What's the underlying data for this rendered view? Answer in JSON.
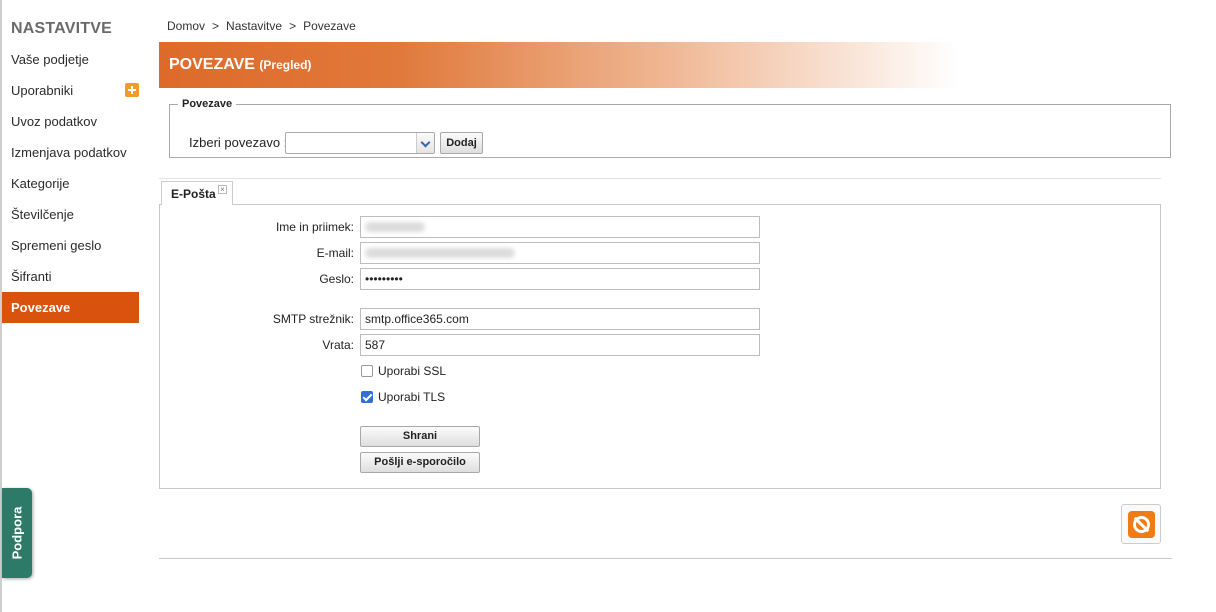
{
  "sidebar": {
    "title": "NASTAVITVE",
    "items": [
      {
        "label": "Vaše podjetje"
      },
      {
        "label": "Uporabniki"
      },
      {
        "label": "Uvoz podatkov"
      },
      {
        "label": "Izmenjava podatkov"
      },
      {
        "label": "Kategorije"
      },
      {
        "label": "Številčenje"
      },
      {
        "label": "Spremeni geslo"
      },
      {
        "label": "Šifranti"
      },
      {
        "label": "Povezave"
      }
    ],
    "active_item": "Povezave"
  },
  "support_tab": {
    "label": "Podpora"
  },
  "breadcrumb": {
    "items": [
      "Domov",
      "Nastavitve",
      "Povezave"
    ],
    "separator": ">"
  },
  "header": {
    "title": "POVEZAVE",
    "subtitle": "(Pregled)"
  },
  "connections": {
    "legend": "Povezave",
    "select_label": "Izberi povezavo :",
    "select_value": "",
    "add_label": "Dodaj"
  },
  "tabs": [
    {
      "label": "E-Pošta",
      "close": "×"
    }
  ],
  "form": {
    "name_label": "Ime in priimek:",
    "name_value": "",
    "email_label": "E-mail:",
    "email_value": "",
    "password_label": "Geslo:",
    "password_value": "•••••••••",
    "smtp_label": "SMTP strežnik:",
    "smtp_value": "smtp.office365.com",
    "port_label": "Vrata:",
    "port_value": "587",
    "ssl_label": "Uporabi SSL",
    "ssl_checked": false,
    "tls_label": "Uporabi TLS",
    "tls_checked": true,
    "save_label": "Shrani",
    "send_label": "Pošlji e-sporočilo"
  },
  "icons": {
    "plus": "plus-icon",
    "cancel": "cancel-icon",
    "dropdown": "chevron-down-icon"
  },
  "colors": {
    "accent": "#d9520e",
    "header_start": "#de6a2a",
    "support": "#2e7a68",
    "checkbox": "#2f6fd6"
  }
}
